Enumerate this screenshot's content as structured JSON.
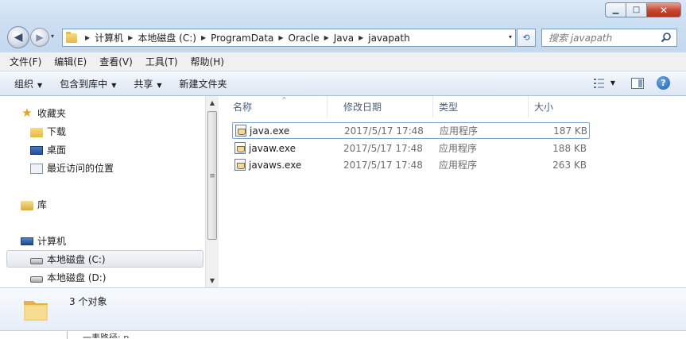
{
  "window": {
    "controls": {
      "minimize": "▁",
      "maximize": "□",
      "close": "✕"
    }
  },
  "nav": {
    "back_glyph": "◀",
    "forward_glyph": "▶",
    "history_glyph": "▾"
  },
  "address": {
    "crumbs": [
      "计算机",
      "本地磁盘 (C:)",
      "ProgramData",
      "Oracle",
      "Java",
      "javapath"
    ],
    "separator": "▶",
    "dropdown_glyph": "▾",
    "refresh_glyph": "⟲"
  },
  "search": {
    "placeholder": "搜索 javapath"
  },
  "menubar": {
    "items": [
      "文件(F)",
      "编辑(E)",
      "查看(V)",
      "工具(T)",
      "帮助(H)"
    ]
  },
  "commandbar": {
    "organize": "组织",
    "include_in_library": "包含到库中",
    "share": "共享",
    "new_folder": "新建文件夹",
    "dropdown_glyph": "▼",
    "help_glyph": "?"
  },
  "navpane": {
    "favorites": "收藏夹",
    "downloads": "下载",
    "desktop": "桌面",
    "recent": "最近访问的位置",
    "libraries": "库",
    "computer": "计算机",
    "drive_c": "本地磁盘 (C:)",
    "drive_d": "本地磁盘 (D:)"
  },
  "scrollbar": {
    "up": "▲",
    "down": "▼",
    "grip": "≡"
  },
  "columns": {
    "name": "名称",
    "date": "修改日期",
    "type": "类型",
    "size": "大小",
    "sort_glyph": "^"
  },
  "files": [
    {
      "name": "java.exe",
      "date": "2017/5/17 17:48",
      "type": "应用程序",
      "size": "187 KB"
    },
    {
      "name": "javaw.exe",
      "date": "2017/5/17 17:48",
      "type": "应用程序",
      "size": "188 KB"
    },
    {
      "name": "javaws.exe",
      "date": "2017/5/17 17:48",
      "type": "应用程序",
      "size": "263 KB"
    }
  ],
  "details": {
    "count": "3 个对象"
  },
  "below": {
    "text": "一表路径: p"
  }
}
